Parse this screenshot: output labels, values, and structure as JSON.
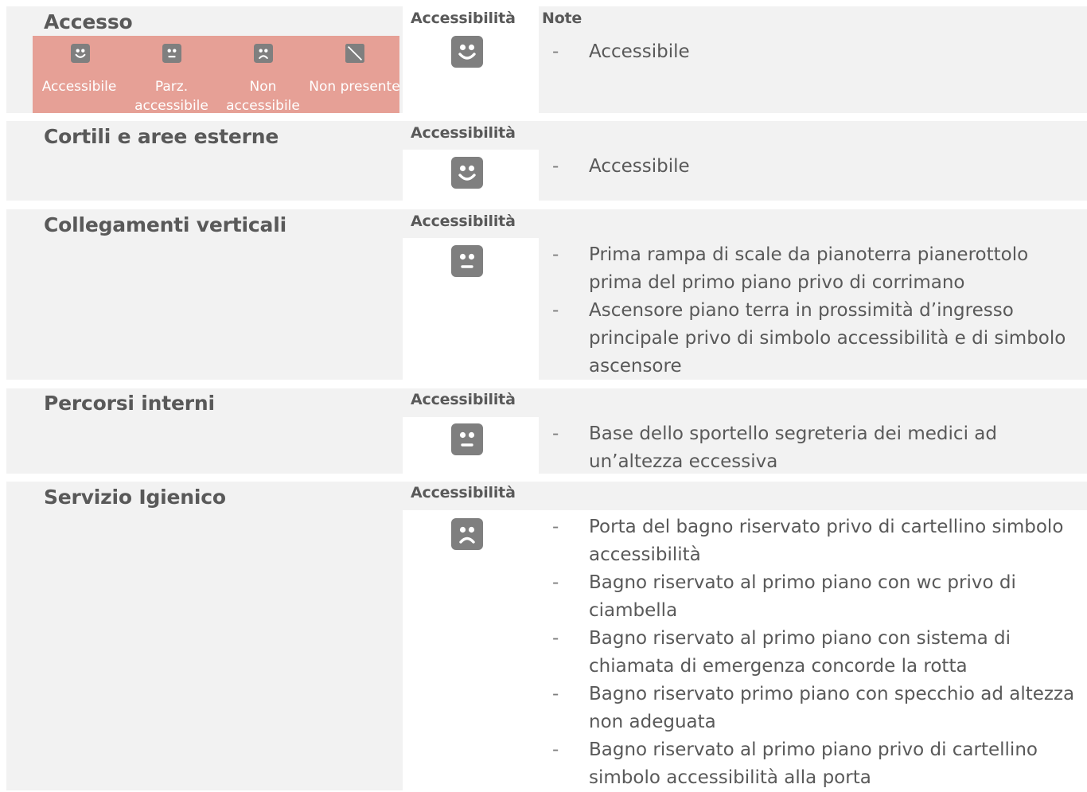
{
  "sections": [
    {
      "title": "Accesso",
      "accessibility_label": "Accessibilità",
      "notes_label": "Note",
      "status_icon": "happy-face-icon",
      "notes": [
        "Accessibile"
      ]
    },
    {
      "title": "Cortili e aree esterne",
      "accessibility_label": "Accessibilità",
      "status_icon": "happy-face-icon",
      "notes": [
        "Accessibile"
      ]
    },
    {
      "title": "Collegamenti verticali",
      "accessibility_label": "Accessibilità",
      "status_icon": "neutral-face-icon",
      "notes": [
        "Prima rampa di scale da pianoterra pianerottolo prima del primo piano privo di corrimano",
        "Ascensore piano terra in prossimità d’ingresso principale privo di simbolo accessibilità e di simbolo ascensore"
      ]
    },
    {
      "title": "Percorsi interni",
      "accessibility_label": "Accessibilità",
      "status_icon": "neutral-face-icon",
      "notes": [
        "Base dello sportello segreteria dei medici ad un’altezza eccessiva"
      ]
    },
    {
      "title": "Servizio Igienico",
      "accessibility_label": "Accessibilità",
      "status_icon": "sad-face-icon",
      "notes": [
        "Porta del bagno riservato privo di cartellino simbolo accessibilità",
        "Bagno riservato al primo piano con wc privo di ciambella",
        "Bagno riservato al primo piano con sistema di chiamata di emergenza concorde la rotta",
        "Bagno riservato primo piano con specchio ad altezza non adeguata",
        "Bagno riservato al primo piano privo di cartellino simbolo accessibilità alla porta"
      ]
    }
  ],
  "legend": {
    "items": [
      {
        "icon": "happy-face-icon",
        "label": "Accessibile"
      },
      {
        "icon": "neutral-face-icon",
        "label": "Parz. accessibile"
      },
      {
        "icon": "sad-face-icon",
        "label": "Non accessibile"
      },
      {
        "icon": "not-present-icon",
        "label": "Non presente"
      }
    ]
  },
  "colors": {
    "panel_gray": "#f2f2f2",
    "legend_bg": "#e6a096",
    "icon_gray": "#7f7f7f",
    "text": "#595959"
  }
}
